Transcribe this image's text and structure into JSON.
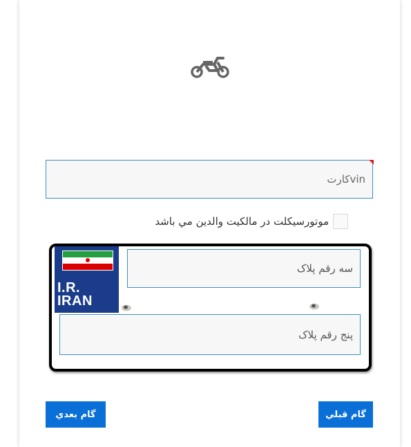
{
  "header": {
    "icon": "motorcycle-icon",
    "icon_color": "#666666"
  },
  "form": {
    "vin_placeholder": "vinکارت",
    "vin_value": "",
    "parent_ownership_checked": false,
    "parent_ownership_label": "موتورسيكلت در مالكيت والدين مي باشد"
  },
  "plate": {
    "country_label_line1": "I.R.",
    "country_label_line2": "IRAN",
    "flag": "iran-flag-icon",
    "three_digit_placeholder": "سه رقم پلاک",
    "five_digit_placeholder": "پنج رقم پلاک"
  },
  "buttons": {
    "next_label": "گام بعدي",
    "prev_label": "گام قبلي"
  },
  "colors": {
    "accent": "#0a6fd6",
    "input_border": "#3b8fc8",
    "plate_blue": "#1a3c8a",
    "required": "#e02020"
  }
}
